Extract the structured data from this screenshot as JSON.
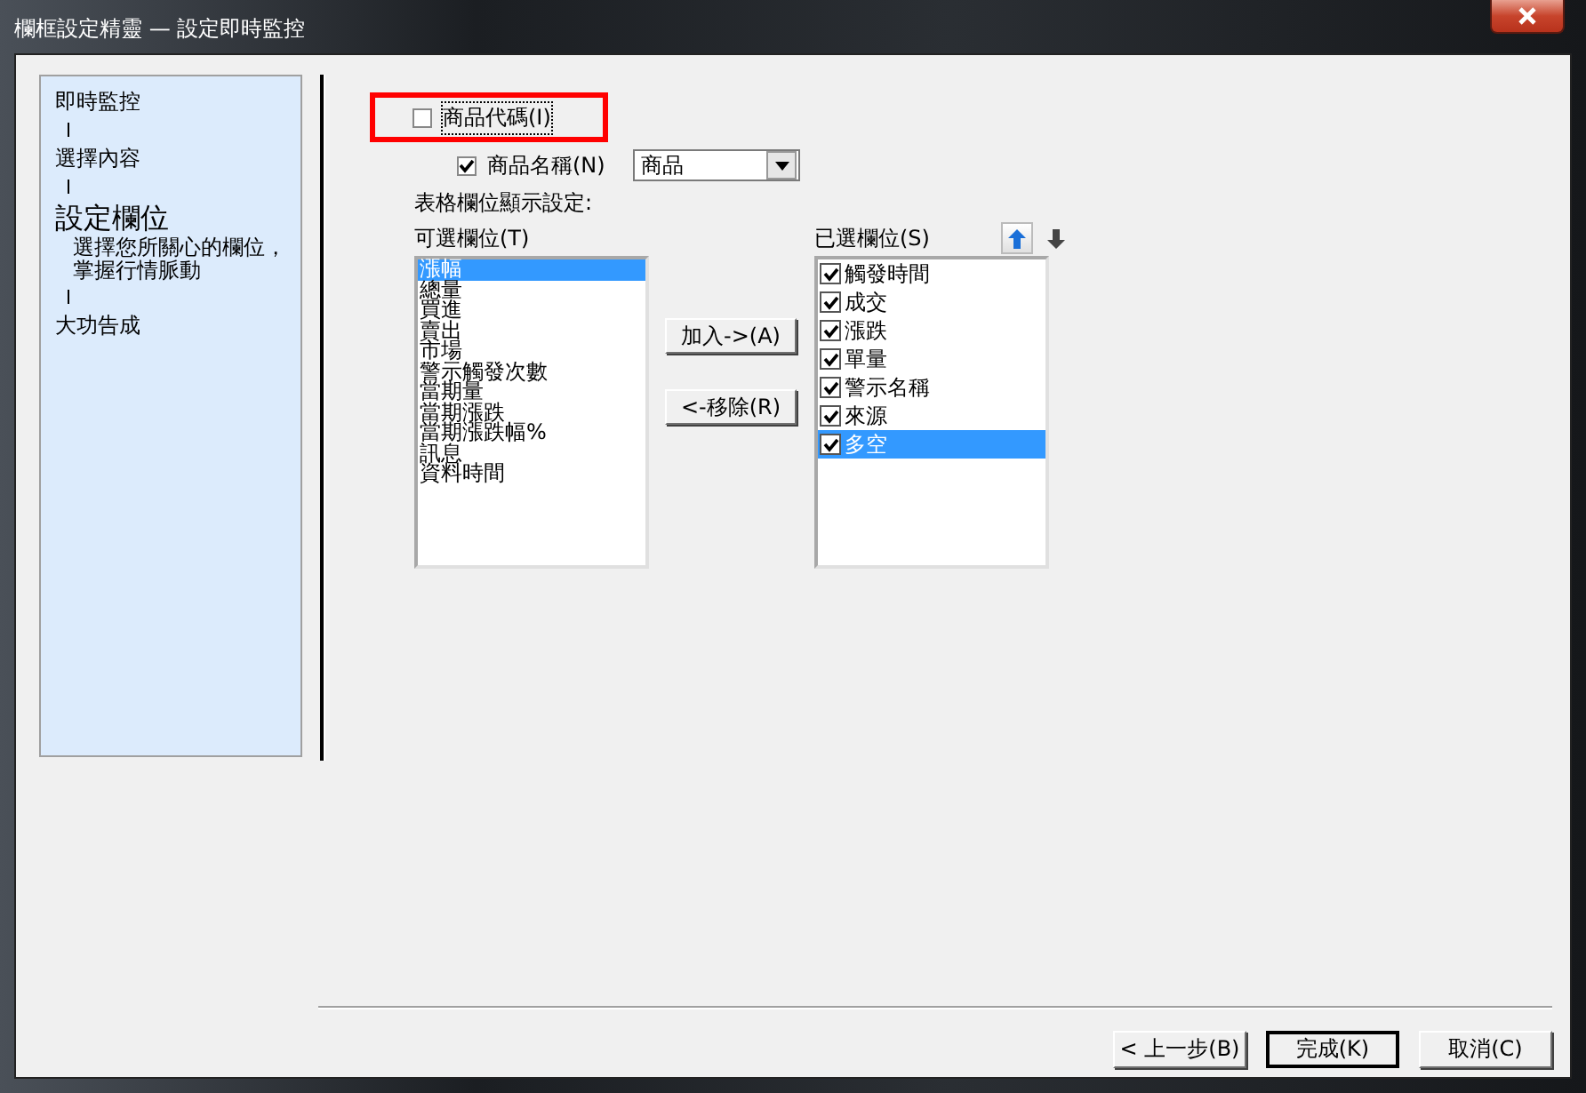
{
  "window": {
    "title": "欄框設定精靈 — 設定即時監控"
  },
  "steps": [
    {
      "label": "即時監控",
      "selected": false
    },
    {
      "label": "選擇內容",
      "selected": false
    },
    {
      "label": "設定欄位",
      "selected": true,
      "description": "選擇您所關心的欄位，掌握行情脈動"
    },
    {
      "label": "大功告成",
      "selected": false
    }
  ],
  "options": [
    {
      "label": "商品代碼(I)",
      "checked": false,
      "highlighted": true
    },
    {
      "label": "商品名稱(N)",
      "checked": true,
      "highlighted": false
    }
  ],
  "name_dropdown": {
    "value": "商品"
  },
  "table_settings_label": "表格欄位顯示設定:",
  "available": {
    "label": "可選欄位(T)",
    "items": [
      {
        "text": "漲幅",
        "selected": true
      },
      {
        "text": "總量",
        "selected": false
      },
      {
        "text": "買進",
        "selected": false
      },
      {
        "text": "賣出",
        "selected": false
      },
      {
        "text": "市場",
        "selected": false
      },
      {
        "text": "警示觸發次數",
        "selected": false
      },
      {
        "text": "當期量",
        "selected": false
      },
      {
        "text": "當期漲跌",
        "selected": false
      },
      {
        "text": "當期漲跌幅%",
        "selected": false
      },
      {
        "text": "訊息",
        "selected": false
      },
      {
        "text": "資料時間",
        "selected": false
      }
    ]
  },
  "add_button": "加入->(A)",
  "remove_button": "<-移除(R)",
  "chosen": {
    "label": "已選欄位(S)",
    "items": [
      {
        "text": "觸發時間",
        "checked": true,
        "selected": false
      },
      {
        "text": "成交",
        "checked": true,
        "selected": false
      },
      {
        "text": "漲跌",
        "checked": true,
        "selected": false
      },
      {
        "text": "單量",
        "checked": true,
        "selected": false
      },
      {
        "text": "警示名稱",
        "checked": true,
        "selected": false
      },
      {
        "text": "來源",
        "checked": true,
        "selected": false
      },
      {
        "text": "多空",
        "checked": true,
        "selected": true
      }
    ]
  },
  "footer_buttons": [
    "< 上一步(B)",
    "完成(K)",
    "取消(C)"
  ]
}
